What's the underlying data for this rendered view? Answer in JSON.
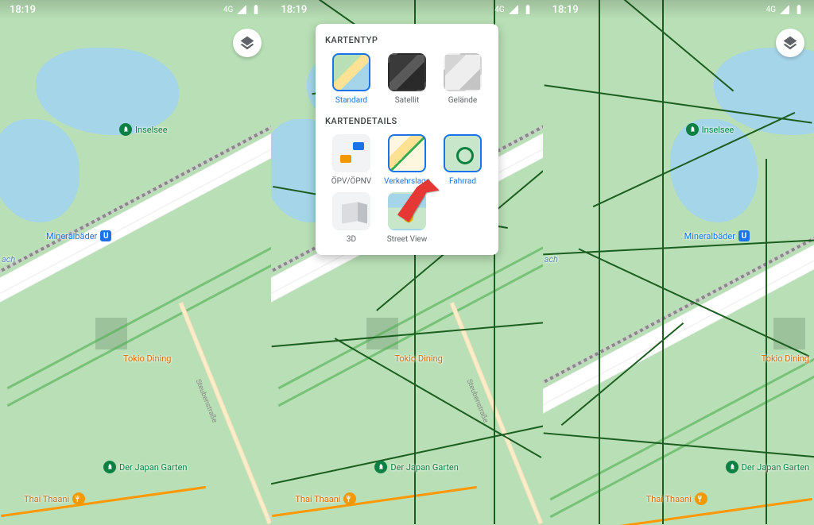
{
  "status": {
    "time": "18:19",
    "network": "4G"
  },
  "pois": {
    "inselsee": "Inselsee",
    "mineralbader": "Mineralbäder",
    "tokio_dining": "Tokio Dining",
    "japan_garten": "Der Japan Garten",
    "thai_thaani": "Thai Thaani",
    "steubenstrasse": "Steubenstraße",
    "bach_suffix": "ach",
    "transit_u": "U"
  },
  "dialog": {
    "section_type": "KARTENTYP",
    "section_details": "KARTENDETAILS",
    "options": {
      "standard": "Standard",
      "satellite": "Satellit",
      "terrain": "Gelände",
      "transit": "ÖPV/ÖPNV",
      "traffic": "Verkehrslage",
      "bike": "Fahrrad",
      "threed": "3D",
      "streetview": "Street View"
    }
  }
}
